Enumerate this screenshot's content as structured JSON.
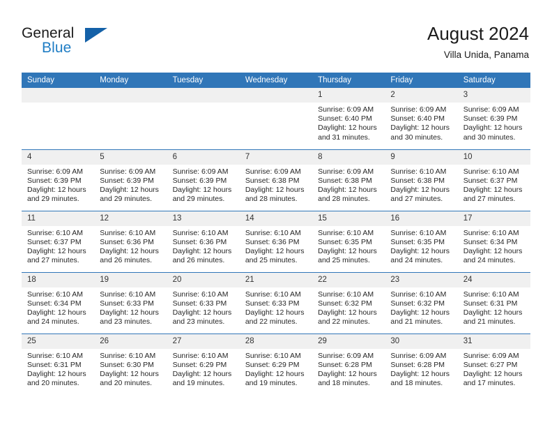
{
  "brand": {
    "name_top": "General",
    "name_bottom": "Blue",
    "triangle_color": "#1461a8",
    "blue_color": "#1f7dc4"
  },
  "header": {
    "title": "August 2024",
    "subtitle": "Villa Unida, Panama"
  },
  "theme": {
    "header_blue": "#3076b8",
    "daynum_band": "#f0f0f0"
  },
  "weekday_headers": [
    "Sunday",
    "Monday",
    "Tuesday",
    "Wednesday",
    "Thursday",
    "Friday",
    "Saturday"
  ],
  "labels": {
    "sunrise_prefix": "Sunrise: ",
    "sunset_prefix": "Sunset: ",
    "daylight_prefix": "Daylight: "
  },
  "weeks": [
    [
      {
        "day": "",
        "sunrise": "",
        "sunset": "",
        "daylight_line1": "",
        "daylight_line2": ""
      },
      {
        "day": "",
        "sunrise": "",
        "sunset": "",
        "daylight_line1": "",
        "daylight_line2": ""
      },
      {
        "day": "",
        "sunrise": "",
        "sunset": "",
        "daylight_line1": "",
        "daylight_line2": ""
      },
      {
        "day": "",
        "sunrise": "",
        "sunset": "",
        "daylight_line1": "",
        "daylight_line2": ""
      },
      {
        "day": "1",
        "sunrise": "Sunrise: 6:09 AM",
        "sunset": "Sunset: 6:40 PM",
        "daylight_line1": "Daylight: 12 hours",
        "daylight_line2": "and 31 minutes."
      },
      {
        "day": "2",
        "sunrise": "Sunrise: 6:09 AM",
        "sunset": "Sunset: 6:40 PM",
        "daylight_line1": "Daylight: 12 hours",
        "daylight_line2": "and 30 minutes."
      },
      {
        "day": "3",
        "sunrise": "Sunrise: 6:09 AM",
        "sunset": "Sunset: 6:39 PM",
        "daylight_line1": "Daylight: 12 hours",
        "daylight_line2": "and 30 minutes."
      }
    ],
    [
      {
        "day": "4",
        "sunrise": "Sunrise: 6:09 AM",
        "sunset": "Sunset: 6:39 PM",
        "daylight_line1": "Daylight: 12 hours",
        "daylight_line2": "and 29 minutes."
      },
      {
        "day": "5",
        "sunrise": "Sunrise: 6:09 AM",
        "sunset": "Sunset: 6:39 PM",
        "daylight_line1": "Daylight: 12 hours",
        "daylight_line2": "and 29 minutes."
      },
      {
        "day": "6",
        "sunrise": "Sunrise: 6:09 AM",
        "sunset": "Sunset: 6:39 PM",
        "daylight_line1": "Daylight: 12 hours",
        "daylight_line2": "and 29 minutes."
      },
      {
        "day": "7",
        "sunrise": "Sunrise: 6:09 AM",
        "sunset": "Sunset: 6:38 PM",
        "daylight_line1": "Daylight: 12 hours",
        "daylight_line2": "and 28 minutes."
      },
      {
        "day": "8",
        "sunrise": "Sunrise: 6:09 AM",
        "sunset": "Sunset: 6:38 PM",
        "daylight_line1": "Daylight: 12 hours",
        "daylight_line2": "and 28 minutes."
      },
      {
        "day": "9",
        "sunrise": "Sunrise: 6:10 AM",
        "sunset": "Sunset: 6:38 PM",
        "daylight_line1": "Daylight: 12 hours",
        "daylight_line2": "and 27 minutes."
      },
      {
        "day": "10",
        "sunrise": "Sunrise: 6:10 AM",
        "sunset": "Sunset: 6:37 PM",
        "daylight_line1": "Daylight: 12 hours",
        "daylight_line2": "and 27 minutes."
      }
    ],
    [
      {
        "day": "11",
        "sunrise": "Sunrise: 6:10 AM",
        "sunset": "Sunset: 6:37 PM",
        "daylight_line1": "Daylight: 12 hours",
        "daylight_line2": "and 27 minutes."
      },
      {
        "day": "12",
        "sunrise": "Sunrise: 6:10 AM",
        "sunset": "Sunset: 6:36 PM",
        "daylight_line1": "Daylight: 12 hours",
        "daylight_line2": "and 26 minutes."
      },
      {
        "day": "13",
        "sunrise": "Sunrise: 6:10 AM",
        "sunset": "Sunset: 6:36 PM",
        "daylight_line1": "Daylight: 12 hours",
        "daylight_line2": "and 26 minutes."
      },
      {
        "day": "14",
        "sunrise": "Sunrise: 6:10 AM",
        "sunset": "Sunset: 6:36 PM",
        "daylight_line1": "Daylight: 12 hours",
        "daylight_line2": "and 25 minutes."
      },
      {
        "day": "15",
        "sunrise": "Sunrise: 6:10 AM",
        "sunset": "Sunset: 6:35 PM",
        "daylight_line1": "Daylight: 12 hours",
        "daylight_line2": "and 25 minutes."
      },
      {
        "day": "16",
        "sunrise": "Sunrise: 6:10 AM",
        "sunset": "Sunset: 6:35 PM",
        "daylight_line1": "Daylight: 12 hours",
        "daylight_line2": "and 24 minutes."
      },
      {
        "day": "17",
        "sunrise": "Sunrise: 6:10 AM",
        "sunset": "Sunset: 6:34 PM",
        "daylight_line1": "Daylight: 12 hours",
        "daylight_line2": "and 24 minutes."
      }
    ],
    [
      {
        "day": "18",
        "sunrise": "Sunrise: 6:10 AM",
        "sunset": "Sunset: 6:34 PM",
        "daylight_line1": "Daylight: 12 hours",
        "daylight_line2": "and 24 minutes."
      },
      {
        "day": "19",
        "sunrise": "Sunrise: 6:10 AM",
        "sunset": "Sunset: 6:33 PM",
        "daylight_line1": "Daylight: 12 hours",
        "daylight_line2": "and 23 minutes."
      },
      {
        "day": "20",
        "sunrise": "Sunrise: 6:10 AM",
        "sunset": "Sunset: 6:33 PM",
        "daylight_line1": "Daylight: 12 hours",
        "daylight_line2": "and 23 minutes."
      },
      {
        "day": "21",
        "sunrise": "Sunrise: 6:10 AM",
        "sunset": "Sunset: 6:33 PM",
        "daylight_line1": "Daylight: 12 hours",
        "daylight_line2": "and 22 minutes."
      },
      {
        "day": "22",
        "sunrise": "Sunrise: 6:10 AM",
        "sunset": "Sunset: 6:32 PM",
        "daylight_line1": "Daylight: 12 hours",
        "daylight_line2": "and 22 minutes."
      },
      {
        "day": "23",
        "sunrise": "Sunrise: 6:10 AM",
        "sunset": "Sunset: 6:32 PM",
        "daylight_line1": "Daylight: 12 hours",
        "daylight_line2": "and 21 minutes."
      },
      {
        "day": "24",
        "sunrise": "Sunrise: 6:10 AM",
        "sunset": "Sunset: 6:31 PM",
        "daylight_line1": "Daylight: 12 hours",
        "daylight_line2": "and 21 minutes."
      }
    ],
    [
      {
        "day": "25",
        "sunrise": "Sunrise: 6:10 AM",
        "sunset": "Sunset: 6:31 PM",
        "daylight_line1": "Daylight: 12 hours",
        "daylight_line2": "and 20 minutes."
      },
      {
        "day": "26",
        "sunrise": "Sunrise: 6:10 AM",
        "sunset": "Sunset: 6:30 PM",
        "daylight_line1": "Daylight: 12 hours",
        "daylight_line2": "and 20 minutes."
      },
      {
        "day": "27",
        "sunrise": "Sunrise: 6:10 AM",
        "sunset": "Sunset: 6:29 PM",
        "daylight_line1": "Daylight: 12 hours",
        "daylight_line2": "and 19 minutes."
      },
      {
        "day": "28",
        "sunrise": "Sunrise: 6:10 AM",
        "sunset": "Sunset: 6:29 PM",
        "daylight_line1": "Daylight: 12 hours",
        "daylight_line2": "and 19 minutes."
      },
      {
        "day": "29",
        "sunrise": "Sunrise: 6:09 AM",
        "sunset": "Sunset: 6:28 PM",
        "daylight_line1": "Daylight: 12 hours",
        "daylight_line2": "and 18 minutes."
      },
      {
        "day": "30",
        "sunrise": "Sunrise: 6:09 AM",
        "sunset": "Sunset: 6:28 PM",
        "daylight_line1": "Daylight: 12 hours",
        "daylight_line2": "and 18 minutes."
      },
      {
        "day": "31",
        "sunrise": "Sunrise: 6:09 AM",
        "sunset": "Sunset: 6:27 PM",
        "daylight_line1": "Daylight: 12 hours",
        "daylight_line2": "and 17 minutes."
      }
    ]
  ]
}
